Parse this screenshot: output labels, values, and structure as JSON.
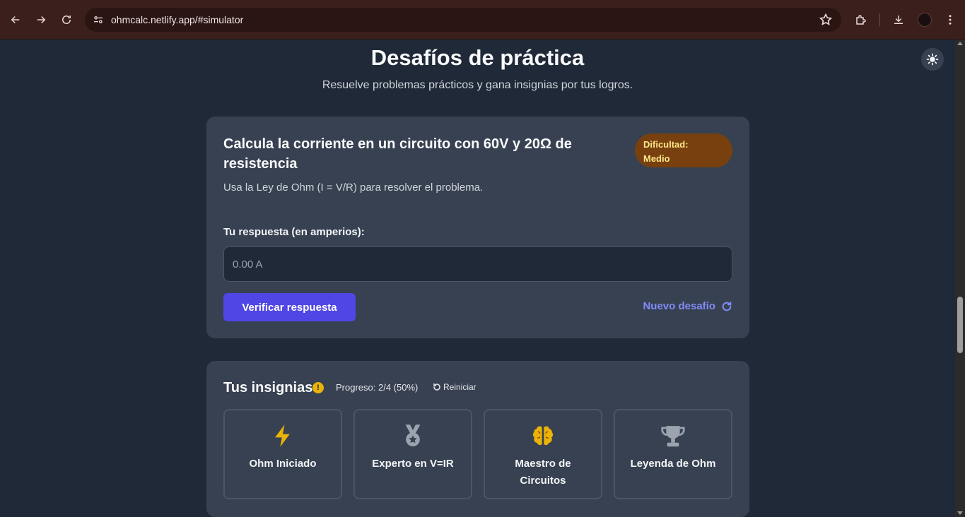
{
  "browser": {
    "url": "ohmcalc.netlify.app/#simulator"
  },
  "header": {
    "title": "Desafíos de práctica",
    "subtitle": "Resuelve problemas prácticos y gana insignias por tus logros."
  },
  "challenge": {
    "title": "Calcula la corriente en un circuito con 60V y 20Ω de resistencia",
    "difficulty_label": "Dificultad:",
    "difficulty_value": "Medio",
    "hint": "Usa la Ley de Ohm (I = V/R) para resolver el problema.",
    "answer_label": "Tu respuesta (en amperios):",
    "answer_placeholder": "0.00 A",
    "answer_value": "",
    "verify_label": "Verificar respuesta",
    "new_label": "Nuevo desafío"
  },
  "badges": {
    "title": "Tus insignias",
    "progress": "Progreso: 2/4 (50%)",
    "reset_label": "Reiniciar",
    "items": [
      {
        "label": "Ohm Iniciado",
        "icon": "bolt-icon",
        "color": "#eab308"
      },
      {
        "label": "Experto en V=IR",
        "icon": "medal-icon",
        "color": "#9ca3af"
      },
      {
        "label": "Maestro de Circuitos",
        "icon": "brain-icon",
        "color": "#eab308"
      },
      {
        "label": "Leyenda de Ohm",
        "icon": "trophy-icon",
        "color": "#9ca3af"
      }
    ]
  },
  "colors": {
    "background": "#1f2937",
    "card": "#374151",
    "accent": "#4f46e5",
    "link": "#818cf8",
    "difficulty_bg": "#78400f",
    "difficulty_text": "#fde68a"
  }
}
